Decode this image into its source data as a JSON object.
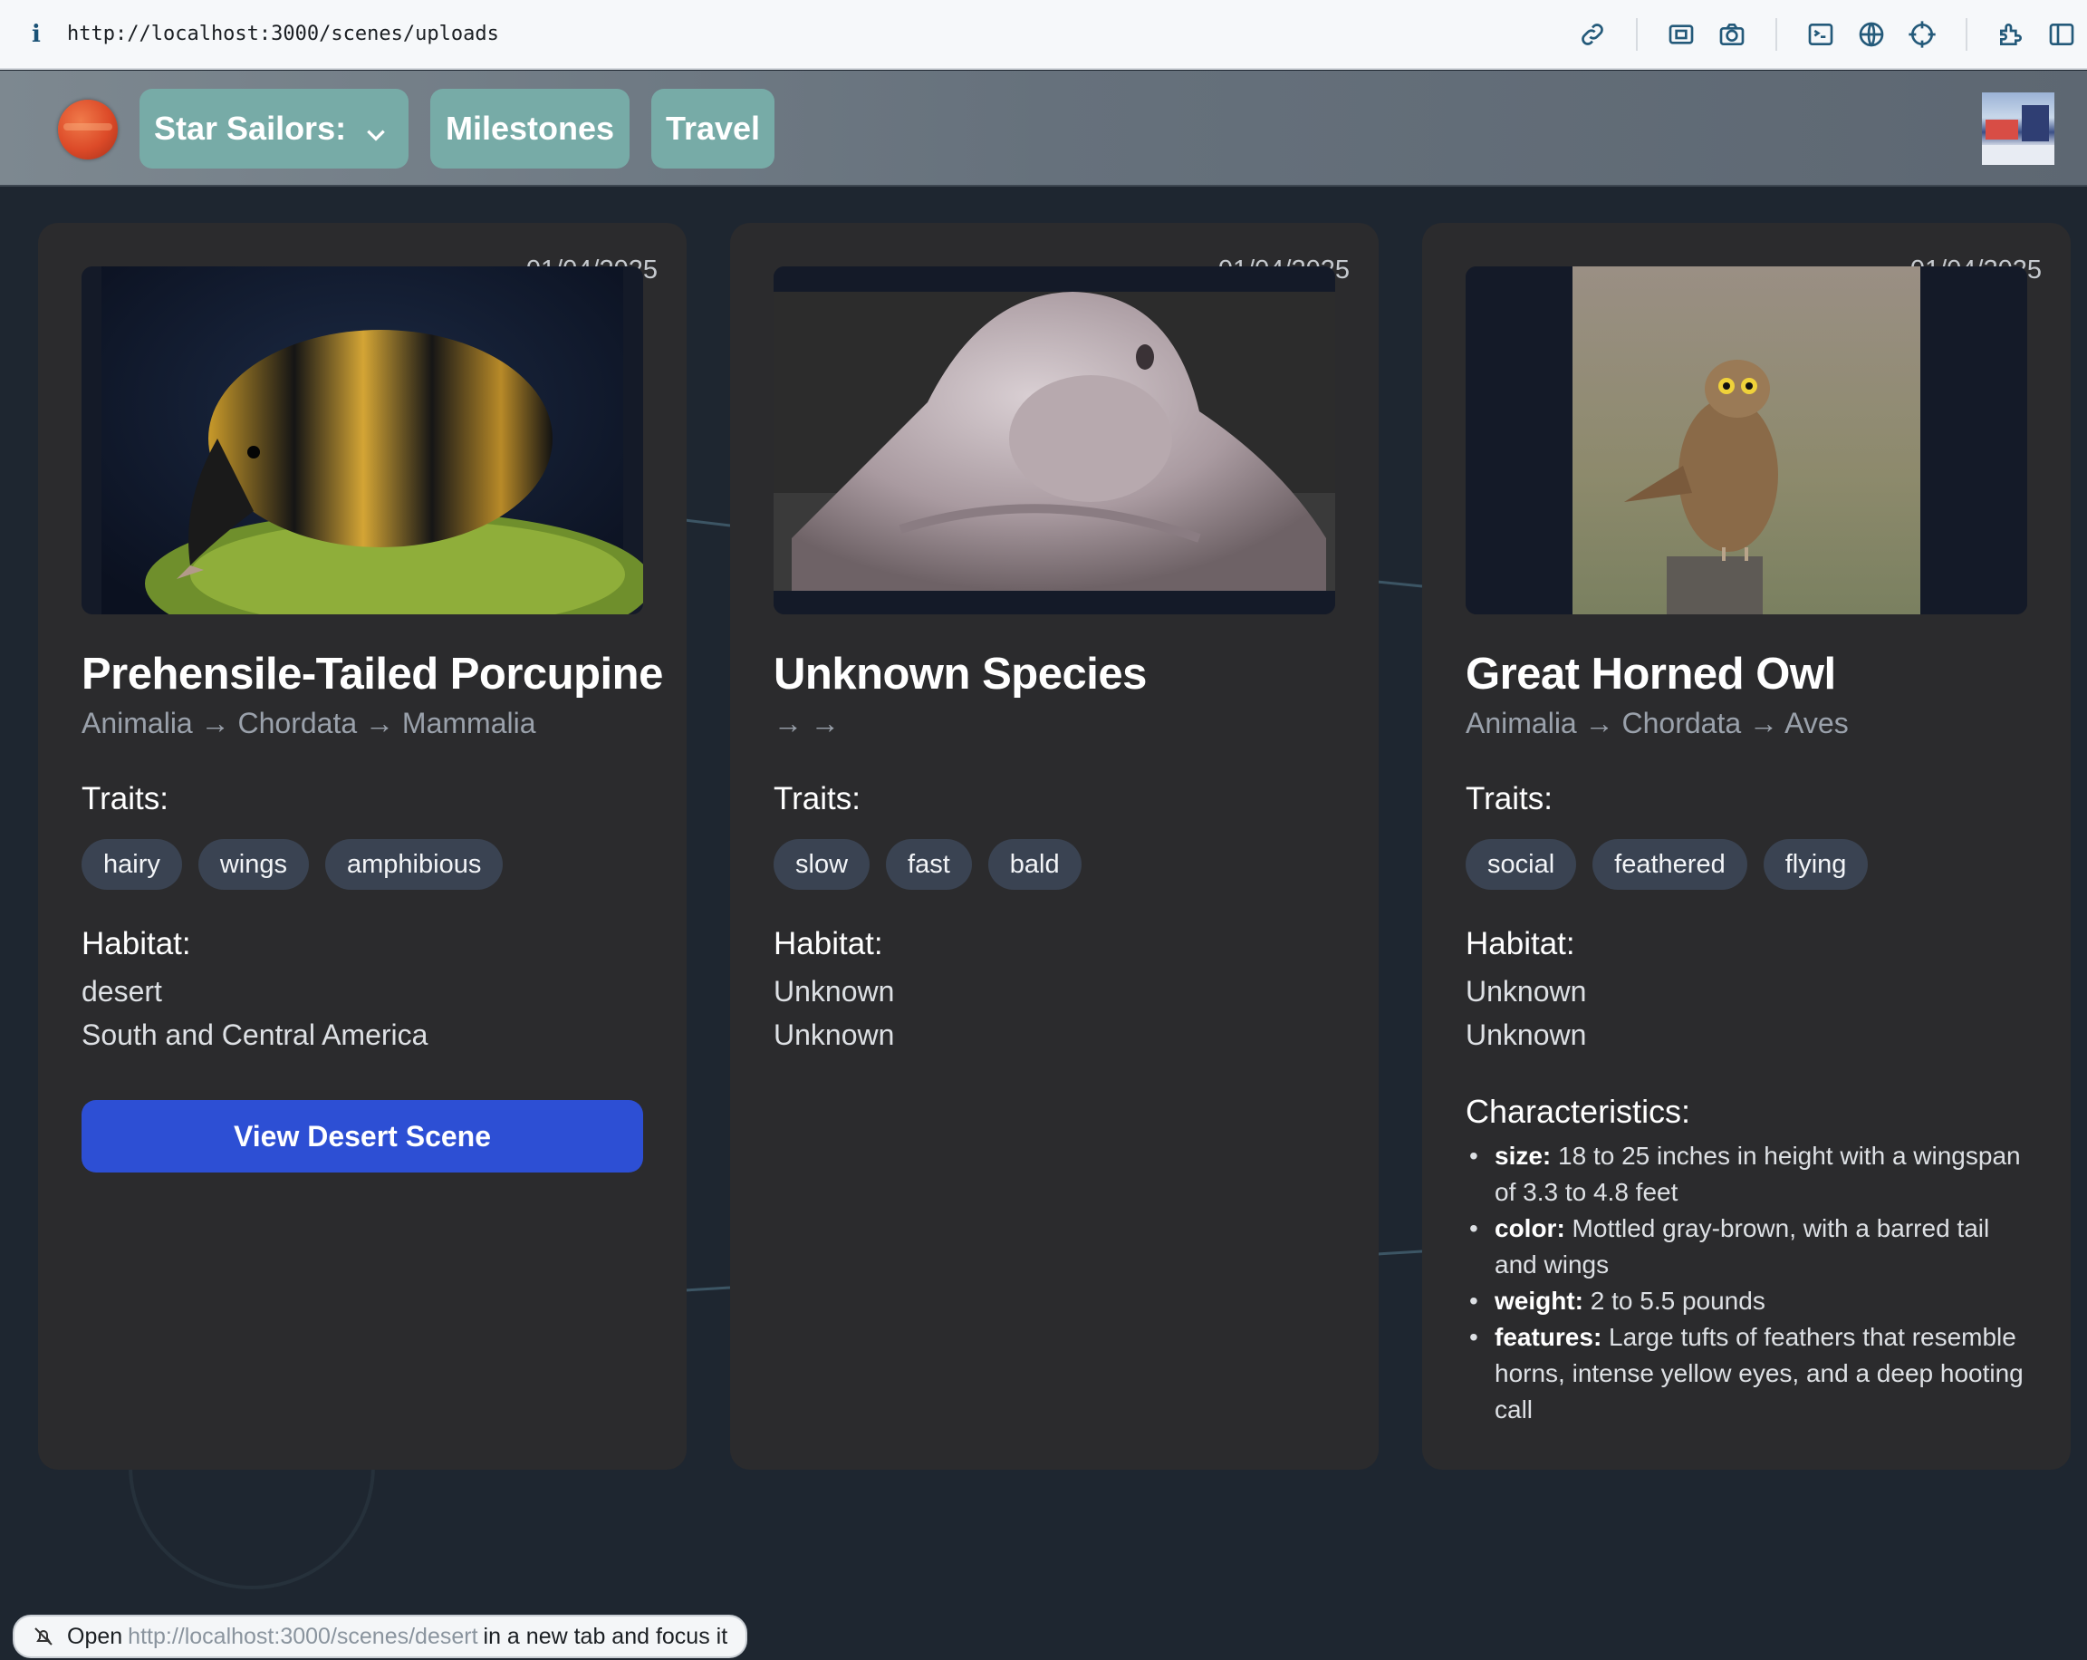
{
  "browser": {
    "url": "http://localhost:3000/scenes/uploads",
    "info_glyph": "i",
    "icons": [
      "link-icon",
      "screenshot-box-icon",
      "camera-icon",
      "terminal-icon",
      "globe-icon",
      "crosshair-icon",
      "extensions-icon",
      "sidebar-icon"
    ]
  },
  "nav": {
    "menu_label": "Star Sailors:",
    "milestones_label": "Milestones",
    "travel_label": "Travel"
  },
  "cards": [
    {
      "date": "01/04/2025",
      "title": "Prehensile-Tailed Porcupine",
      "taxonomy": "Animalia → Chordata → Mammalia",
      "traits_heading": "Traits:",
      "traits": [
        "hairy",
        "wings",
        "amphibious"
      ],
      "habitat_heading": "Habitat:",
      "habitat": [
        "desert",
        "South and Central America"
      ],
      "button_label": "View Desert Scene"
    },
    {
      "date": "01/04/2025",
      "title": "Unknown Species",
      "taxonomy": "→ →",
      "traits_heading": "Traits:",
      "traits": [
        "slow",
        "fast",
        "bald"
      ],
      "habitat_heading": "Habitat:",
      "habitat": [
        "Unknown",
        "Unknown"
      ]
    },
    {
      "date": "01/04/2025",
      "title": "Great Horned Owl",
      "taxonomy": "Animalia → Chordata → Aves",
      "traits_heading": "Traits:",
      "traits": [
        "social",
        "feathered",
        "flying"
      ],
      "habitat_heading": "Habitat:",
      "habitat": [
        "Unknown",
        "Unknown"
      ],
      "characteristics_heading": "Characteristics:",
      "characteristics": [
        {
          "key": "size:",
          "value": " 18 to 25 inches in height with a wingspan of 3.3 to 4.8 feet"
        },
        {
          "key": "color:",
          "value": " Mottled gray-brown, with a barred tail and wings"
        },
        {
          "key": "weight:",
          "value": " 2 to 5.5 pounds"
        },
        {
          "key": "features:",
          "value": " Large tufts of feathers that resemble horns, intense yellow eyes, and a deep hooting call"
        }
      ]
    }
  ],
  "status": {
    "prefix": "Open",
    "link": "http://localhost:3000/scenes/desert",
    "suffix": "in a new tab and focus it"
  },
  "colors": {
    "page_bg": "#1e2630",
    "card_bg": "#2b2b2d",
    "nav_button": "#77aba7",
    "tag_bg": "#3a4352",
    "primary_button": "#2d4fd4"
  }
}
